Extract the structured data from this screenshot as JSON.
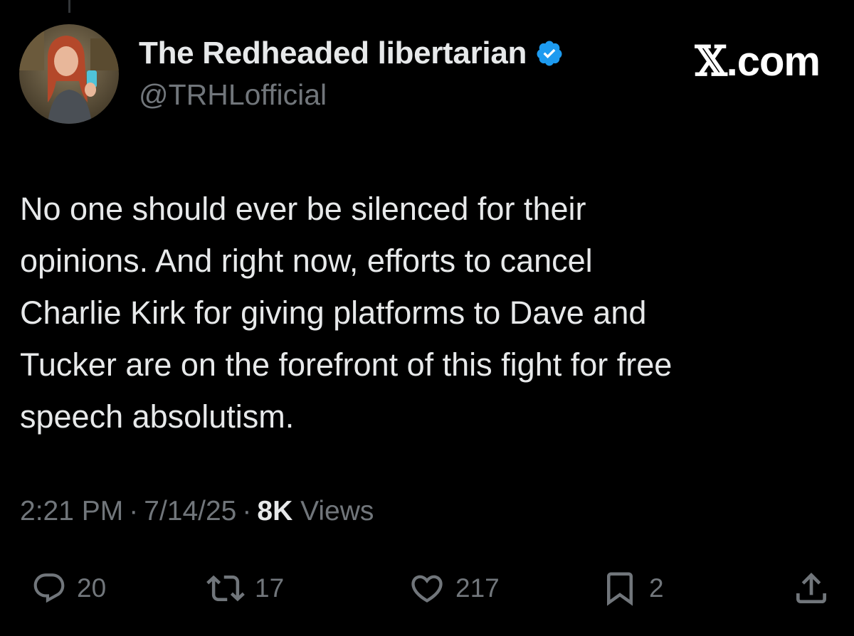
{
  "author": {
    "display_name": "The Redheaded libertarian",
    "handle": "@TRHLofficial",
    "verified": true,
    "avatar_icon": "profile-photo"
  },
  "watermark": {
    "x_glyph": "𝕏",
    "domain": ".com"
  },
  "tweet": {
    "lines": [
      "No one should ever be silenced for their",
      "opinions. And right now, efforts to cancel",
      "Charlie Kirk for giving platforms to Dave and",
      "Tucker are on the forefront of this fight for free",
      "speech absolutism."
    ]
  },
  "meta": {
    "time": "2:21 PM",
    "separator": "·",
    "date": "7/14/25",
    "views_count": "8K",
    "views_label": "Views"
  },
  "actions": {
    "reply": {
      "icon": "reply-icon",
      "count": "20"
    },
    "repost": {
      "icon": "repost-icon",
      "count": "17"
    },
    "like": {
      "icon": "heart-icon",
      "count": "217"
    },
    "bookmark": {
      "icon": "bookmark-icon",
      "count": "2"
    },
    "share": {
      "icon": "share-icon"
    }
  },
  "colors": {
    "background": "#000000",
    "primary_text": "#e7e9ea",
    "secondary_text": "#71767b",
    "verified_badge": "#1d9bf0"
  }
}
